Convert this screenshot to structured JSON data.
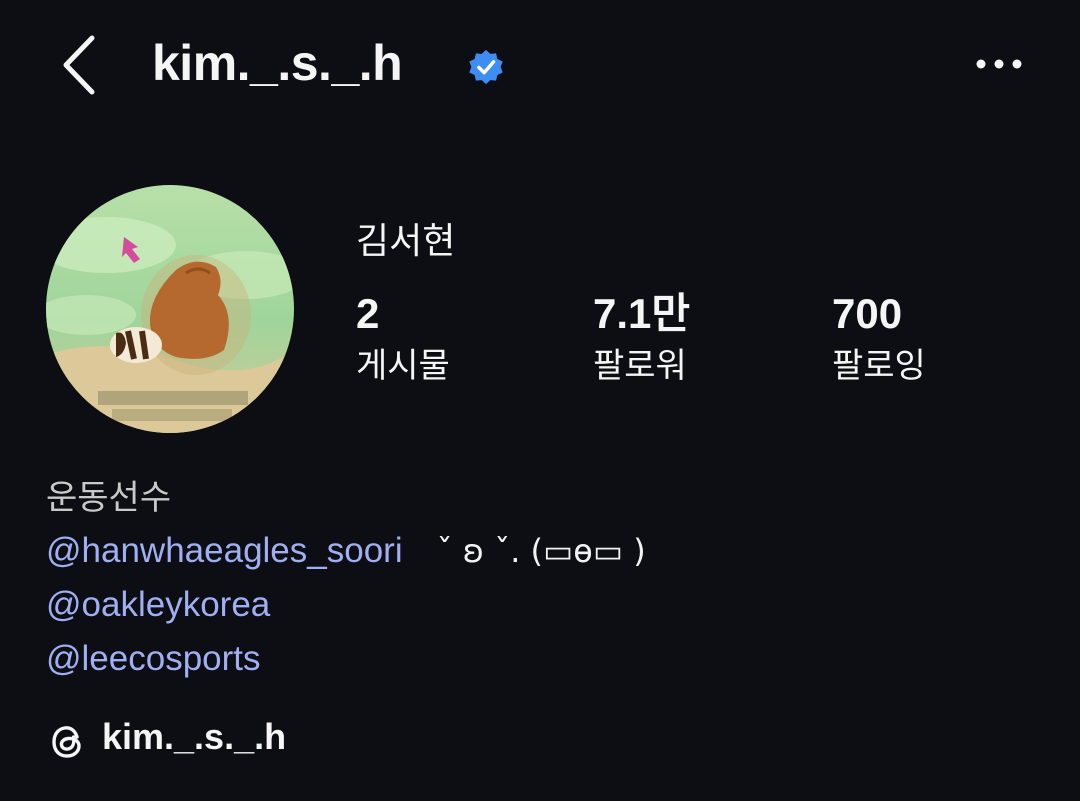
{
  "header": {
    "back_icon": "chevron-left-icon",
    "username": "kim._.s._.h",
    "verified_icon": "verified-badge-icon",
    "more_icon": "more-horizontal-icon"
  },
  "profile": {
    "display_name": "김서현",
    "stats": [
      {
        "value": "2",
        "label": "게시물"
      },
      {
        "value": "7.1만",
        "label": "팔로워"
      },
      {
        "value": "700",
        "label": "팔로잉"
      }
    ],
    "bio": {
      "category": "운동선수",
      "lines": [
        {
          "mention": "@hanwhaeagles_soori",
          "text": "ˇ ʚ ˇ. (▭ɵ▭ )"
        },
        {
          "mention": "@oakleykorea",
          "text": ""
        },
        {
          "mention": "@leecosports",
          "text": ""
        }
      ]
    },
    "threads": {
      "icon": "threads-icon",
      "handle": "kim._.s._.h"
    }
  },
  "colors": {
    "background": "#0c0e14",
    "text": "#f5f5f5",
    "mention": "#a0aef2",
    "verified": "#3e8df2"
  }
}
